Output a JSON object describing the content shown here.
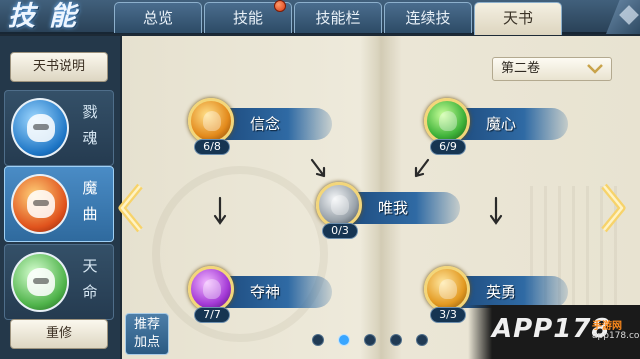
{
  "header": {
    "game_title": "技能",
    "tabs": [
      {
        "label": "总览",
        "active": false
      },
      {
        "label": "技能",
        "active": false,
        "notification": true
      },
      {
        "label": "技能栏",
        "active": false
      },
      {
        "label": "连续技",
        "active": false
      },
      {
        "label": "天书",
        "active": true
      }
    ]
  },
  "sidebar": {
    "explain_label": "天书说明",
    "reset_label": "重修",
    "books": [
      {
        "label": "戮魂",
        "icon": "blue-dragon-emblem-icon",
        "active": false
      },
      {
        "label": "魔曲",
        "icon": "red-demon-emblem-icon",
        "active": true
      },
      {
        "label": "天命",
        "icon": "green-beast-emblem-icon",
        "active": false
      }
    ]
  },
  "volume_select": {
    "value": "第二卷"
  },
  "skills": [
    {
      "name": "信念",
      "count": "6/8",
      "color": "#e38a1c"
    },
    {
      "name": "魔心",
      "count": "6/9",
      "color": "#3fb33a"
    },
    {
      "name": "唯我",
      "count": "0/3",
      "color": "#9aa3ab"
    },
    {
      "name": "夺神",
      "count": "7/7",
      "color": "#a43ad6"
    },
    {
      "name": "英勇",
      "count": "3/3",
      "color": "#e39a22"
    }
  ],
  "recommend_label": [
    "推荐",
    "加点"
  ],
  "pagination": {
    "total": 5,
    "current": 1
  },
  "watermark": {
    "logo": "APP178",
    "sub": "手游网",
    "url": "app178.com"
  },
  "colors": {
    "accent": "#39a6ff",
    "tab_bar": "#2a4258",
    "page": "#e8e3d1"
  }
}
